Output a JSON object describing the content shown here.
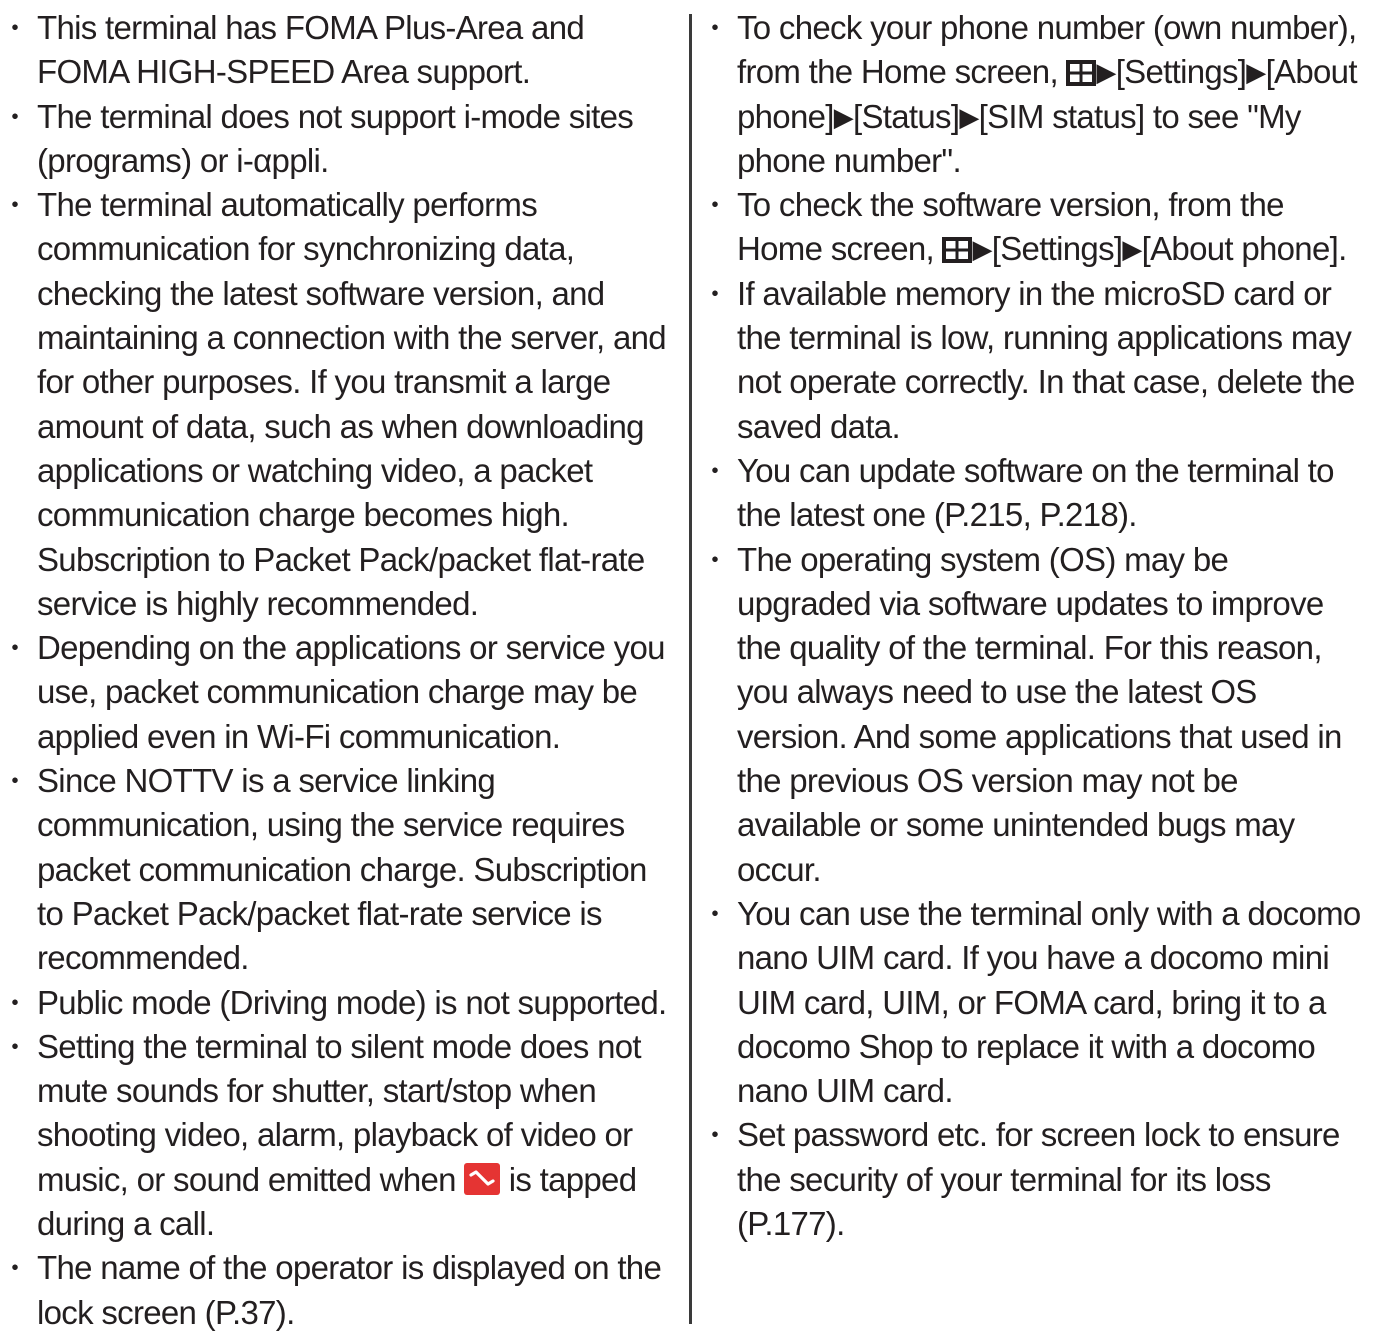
{
  "left_column": {
    "items": [
      "This terminal has FOMA Plus-Area and FOMA HIGH-SPEED Area support.",
      "The terminal does not support i-mode sites (programs) or i-αppli.",
      "The terminal automatically performs communication for synchronizing data, checking the latest software version, and maintaining a connection with the server, and for other purposes. If you transmit a large amount of data, such as when downloading applications or watching video, a packet communication charge becomes high. Subscription to Packet Pack/packet flat-rate service is highly recommended.",
      "Depending on the applications or service you use, packet communication charge may be applied even in Wi-Fi communication.",
      "Since NOTTV is a service linking communication, using the service requires packet communication charge. Subscription to Packet Pack/packet flat-rate service is recommended.",
      "Public mode (Driving mode) is not supported."
    ],
    "silent_mode_item": {
      "before_icon": "Setting the terminal to silent mode does not mute sounds for shutter, start/stop when shooting video, alarm, playback of video or music, or sound emitted when ",
      "icon": "end-call-icon",
      "after_icon": " is tapped during a call."
    },
    "operator_item": "The name of the operator is displayed on the lock screen (P.37)."
  },
  "right_column": {
    "phone_number_item": {
      "part1": "To check your phone number (own number), from the Home screen, ",
      "part2": "[Settings]",
      "part3": "[About phone]",
      "part4": "[Status]",
      "part5": "[SIM status] to see \"My phone number\"."
    },
    "software_version_item": {
      "part1": "To check the software version, from the Home screen, ",
      "part2": "[Settings]",
      "part3": "[About phone]."
    },
    "arrow": "▶",
    "menu_icon": "apps-grid-icon",
    "items": [
      "If available memory in the microSD card or the terminal is low, running applications may not operate correctly. In that case, delete the saved data.",
      "You can update software on the terminal to the latest one (P.215, P.218).",
      "The operating system (OS) may be upgraded via software updates to improve the quality of the terminal. For this reason, you always need to use the latest OS version. And some applications that used in the previous OS version may not be available or some unintended bugs may occur.",
      "You can use the terminal only with a docomo nano UIM card. If you have a docomo mini UIM card, UIM, or FOMA card, bring it to a docomo Shop to replace it with a docomo nano UIM card.",
      "Set password etc. for screen lock to ensure the security of your terminal for its loss (P.177)."
    ]
  },
  "colors": {
    "text": "#231f20",
    "end_call_icon": "#e53433",
    "divider": "#3a3a3a"
  }
}
